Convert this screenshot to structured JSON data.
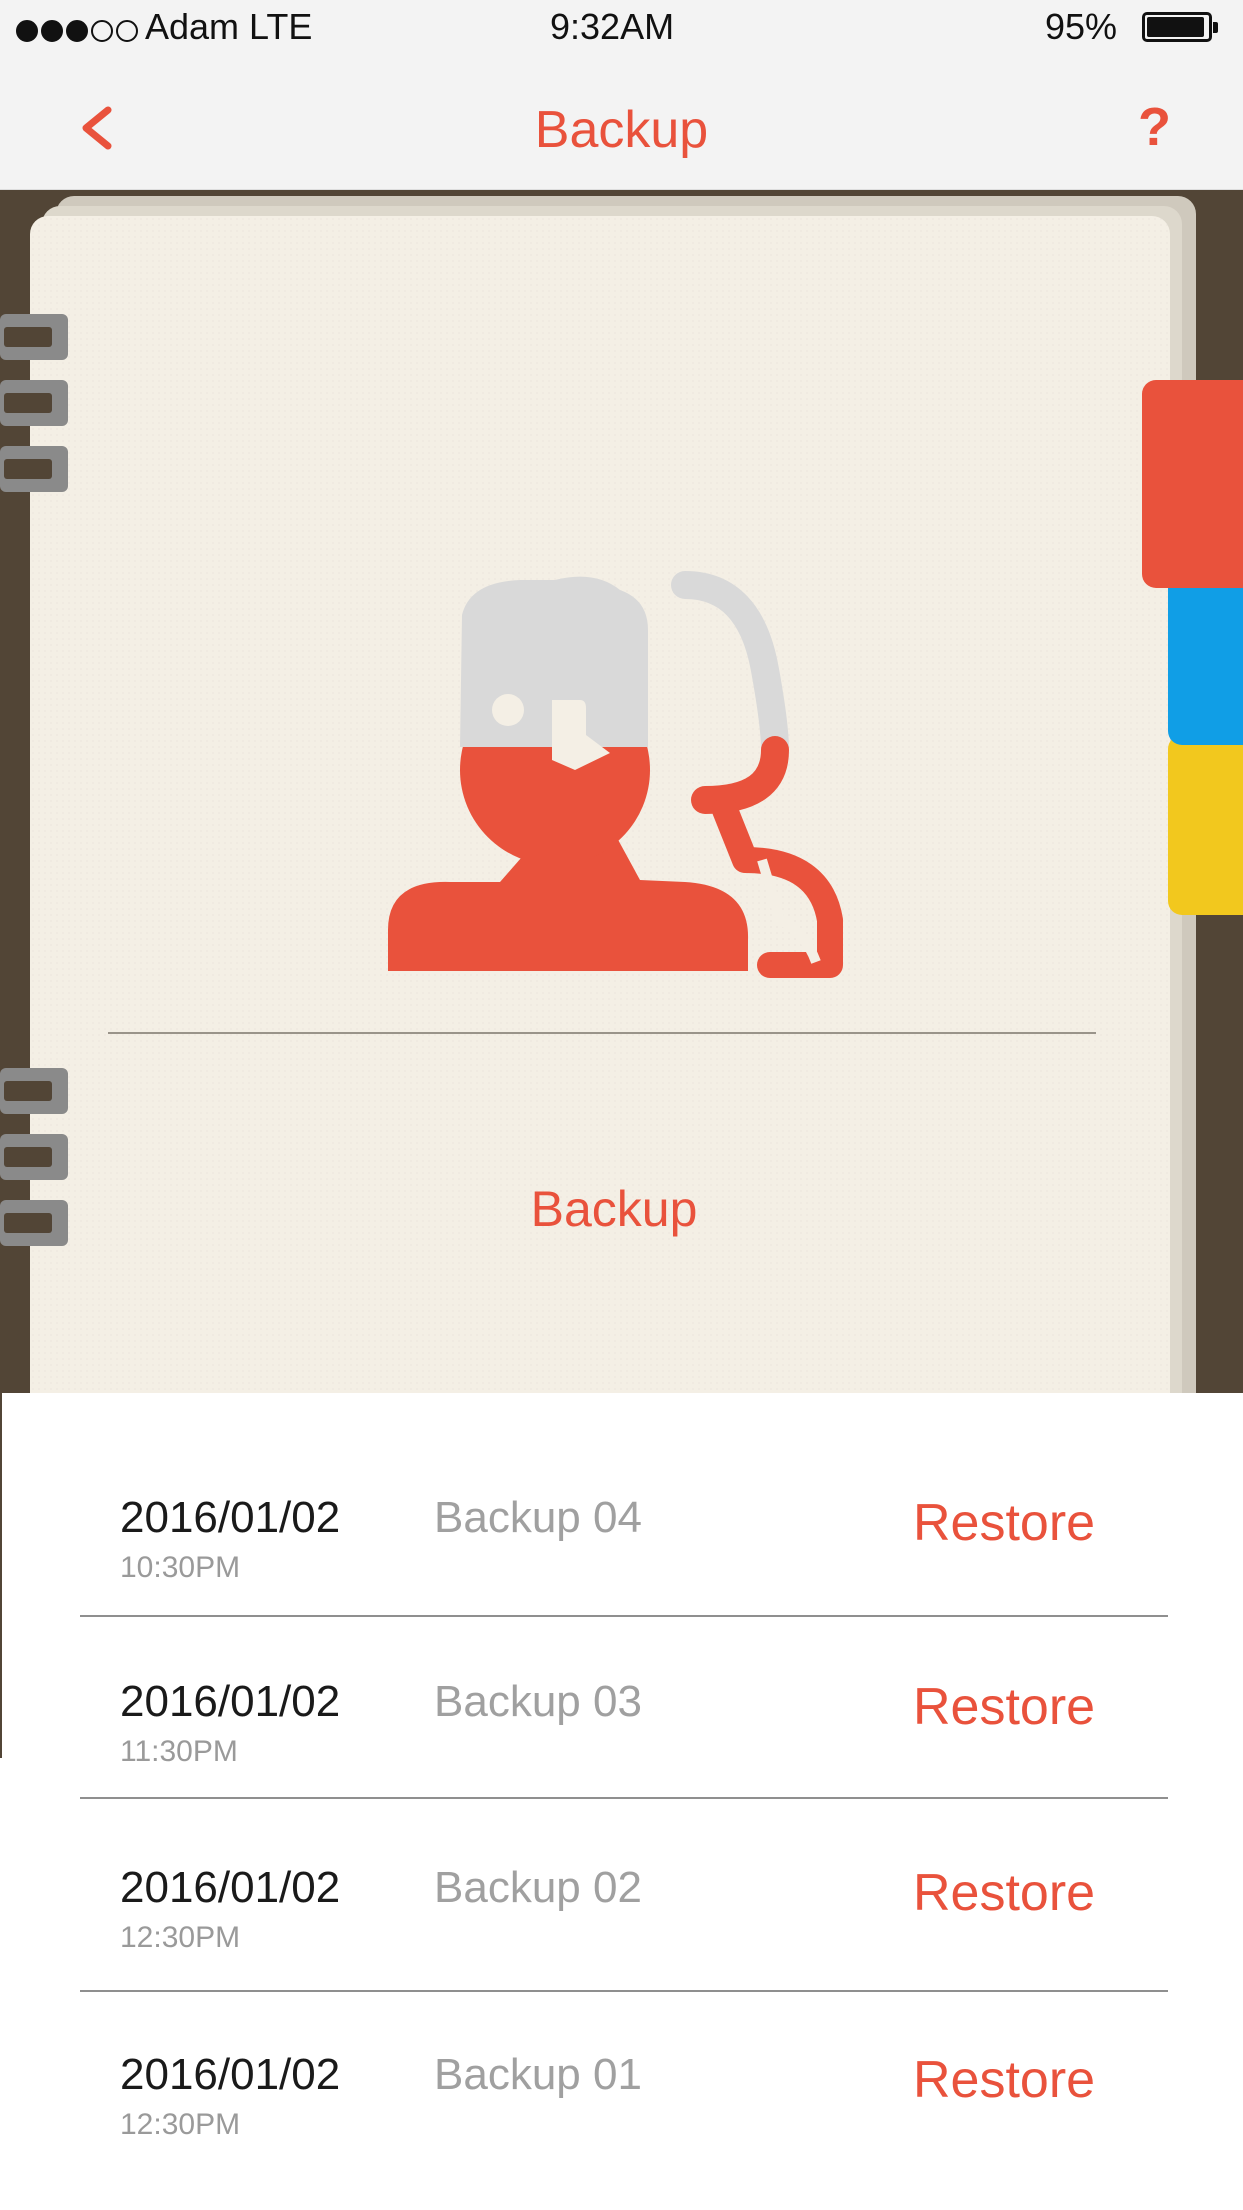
{
  "status_bar": {
    "signal_icon": "signal-dots-icon",
    "carrier": "Adam LTE",
    "time": "9:32AM",
    "battery_percent": "95%",
    "battery_level": 0.95
  },
  "nav": {
    "back_icon": "chevron-left-icon",
    "title": "Backup",
    "help_label": "?"
  },
  "notebook": {
    "illustration_icon": "person-with-headset-icon",
    "label": "Backup",
    "tab_colors": [
      "#e9523c",
      "#109ee6",
      "#f2c81e"
    ]
  },
  "backups": [
    {
      "date": "2016/01/02",
      "time": "10:30PM",
      "name": "Backup 04",
      "action": "Restore"
    },
    {
      "date": "2016/01/02",
      "time": "11:30PM",
      "name": "Backup 03",
      "action": "Restore"
    },
    {
      "date": "2016/01/02",
      "time": "12:30PM",
      "name": "Backup 02",
      "action": "Restore"
    },
    {
      "date": "2016/01/02",
      "time": "12:30PM",
      "name": "Backup 01",
      "action": "Restore"
    }
  ],
  "colors": {
    "accent": "#e9523c",
    "notebook_cover": "#524536",
    "page": "#f4efe5"
  }
}
